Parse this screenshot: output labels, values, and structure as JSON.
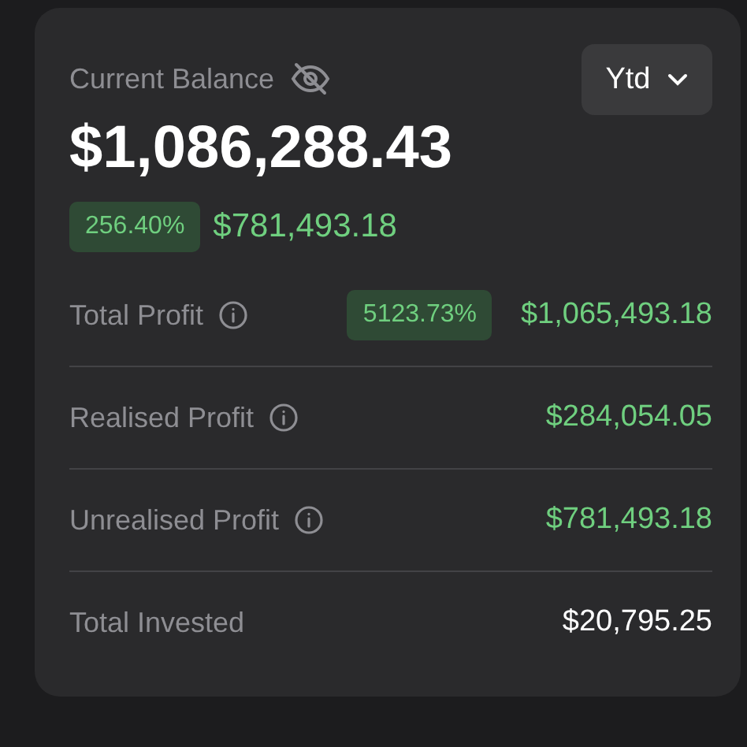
{
  "balance": {
    "label": "Current Balance",
    "hidden_toggle": true,
    "amount": "$1,086,288.43",
    "change_percent": "256.40%",
    "change_amount": "$781,493.18"
  },
  "period": {
    "label": "Ytd"
  },
  "rows": [
    {
      "label": "Total Profit",
      "info": true,
      "badge": "5123.73%",
      "value": "$1,065,493.18",
      "kind": "gain"
    },
    {
      "label": "Realised Profit",
      "info": true,
      "value": "$284,054.05",
      "kind": "gain"
    },
    {
      "label": "Unrealised Profit",
      "info": true,
      "value": "$781,493.18",
      "kind": "gain"
    },
    {
      "label": "Total Invested",
      "info": false,
      "value": "$20,795.25",
      "kind": "plain"
    }
  ]
}
